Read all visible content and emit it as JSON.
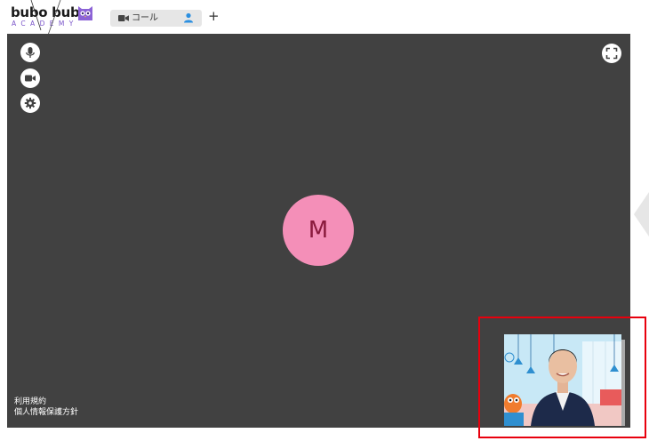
{
  "brand": {
    "name": "bubo bubo",
    "sub": "ACADEMY",
    "accent": "#7a55c9"
  },
  "tabs": [
    {
      "label": "コール",
      "icon": "video-camera-icon",
      "participant_icon": "user-icon",
      "active": true
    }
  ],
  "add_tab_label": "+",
  "controls": {
    "left": [
      "microphone-icon",
      "video-camera-icon",
      "gear-icon"
    ],
    "fullscreen_icon": "fullscreen-icon"
  },
  "participant": {
    "initial": "M",
    "avatar_color": "#f48fb8"
  },
  "footer": {
    "terms": "利用規約",
    "privacy": "個人情報保護方針"
  },
  "colors": {
    "call_background": "#414141",
    "highlight": "#e8000d"
  }
}
